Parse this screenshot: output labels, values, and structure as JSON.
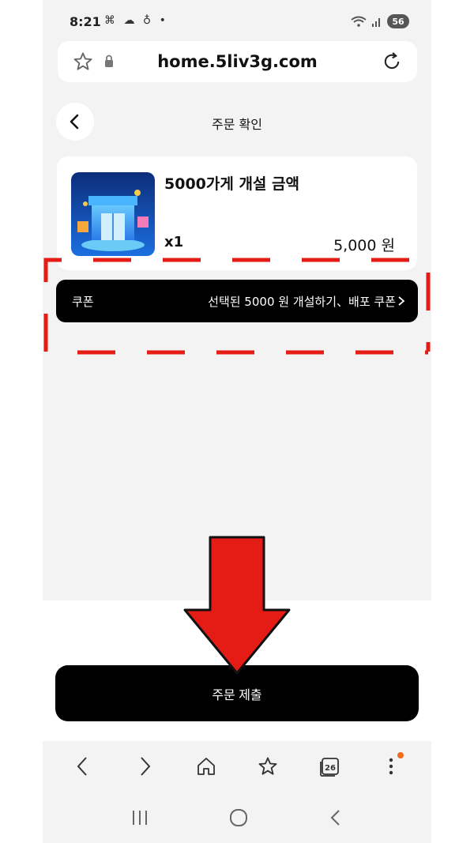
{
  "status_bar": {
    "time": "8:21",
    "left_icons": "⌘ ☁ ♁ •",
    "battery": "56"
  },
  "browser": {
    "url": "home.5liv3g.com"
  },
  "header": {
    "title": "주문 확인"
  },
  "product": {
    "name": "5000가게 개설 금액",
    "quantity": "x1",
    "price": "5,000 원"
  },
  "coupon": {
    "label": "쿠폰",
    "value": "선택된 5000 원 개설하기、배포 쿠폰"
  },
  "submit": {
    "label": "주문 제출"
  },
  "browser_nav": {
    "tabs_count": "26"
  },
  "colors": {
    "accent_red": "#e51b16",
    "dark": "#000000",
    "background": "#f3f3f3",
    "notify": "#f26a1b"
  }
}
